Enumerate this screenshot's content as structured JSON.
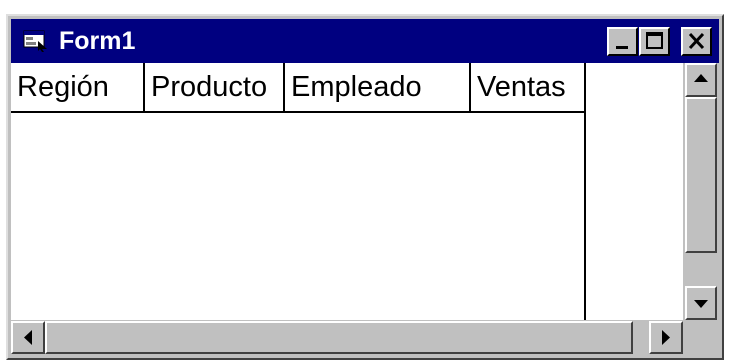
{
  "window": {
    "title": "Form1",
    "app_icon": "form-window-icon"
  },
  "title_buttons": {
    "minimize_icon": "minimize-icon",
    "maximize_icon": "maximize-icon",
    "close_icon": "close-icon"
  },
  "grid": {
    "columns": [
      "Región",
      "Producto",
      "Empleado",
      "Ventas"
    ],
    "rows": []
  },
  "scrollbars": {
    "vertical": {
      "up_icon": "arrow-up-icon",
      "down_icon": "arrow-down-icon"
    },
    "horizontal": {
      "left_icon": "arrow-left-icon",
      "right_icon": "arrow-right-icon"
    }
  },
  "colors": {
    "titlebar": "#000080",
    "face": "#c0c0c0",
    "grid_background": "#ffffff",
    "grid_lines": "#000000"
  }
}
